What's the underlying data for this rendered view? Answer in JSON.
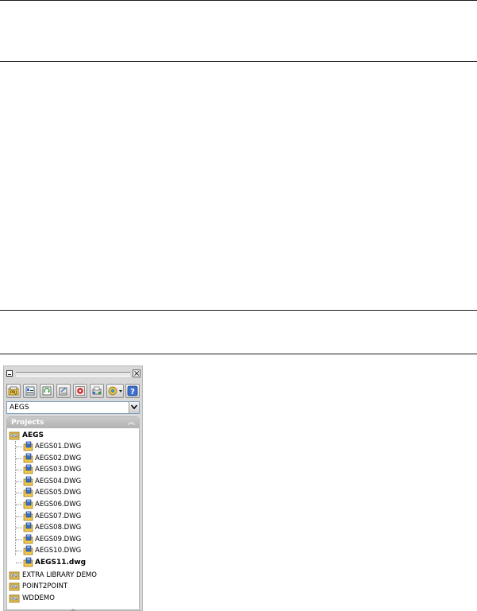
{
  "toolbar": {
    "buttons": [
      {
        "icon": "open-project-icon",
        "tooltip": ""
      },
      {
        "icon": "project-properties-icon",
        "tooltip": ""
      },
      {
        "icon": "update-retag-icon",
        "tooltip": ""
      },
      {
        "icon": "project-task-list-icon",
        "tooltip": ""
      },
      {
        "icon": "project-wide-utilities-icon",
        "tooltip": ""
      },
      {
        "icon": "plot-project-icon",
        "tooltip": ""
      },
      {
        "icon": "project-reports-icon",
        "tooltip": ""
      },
      {
        "icon": "help-icon",
        "tooltip": ""
      }
    ]
  },
  "project_selector": {
    "value": "AEGS"
  },
  "tree": {
    "header": "Projects",
    "active_project": "AEGS",
    "drawings": [
      "AEGS01.DWG",
      "AEGS02.DWG",
      "AEGS03.DWG",
      "AEGS04.DWG",
      "AEGS05.DWG",
      "AEGS06.DWG",
      "AEGS07.DWG",
      "AEGS08.DWG",
      "AEGS09.DWG",
      "AEGS10.DWG",
      "AEGS11.dwg"
    ],
    "other_projects": [
      "EXTRA LIBRARY DEMO",
      "POINT2POINT",
      "WDDEMO"
    ]
  },
  "colors": {
    "panel_bg": "#d8d8d8",
    "header_bg": "#b3b3b3",
    "folder_yellow": "#f2c94c",
    "drawing_blue": "#3b6fc4",
    "help_blue": "#3a6fd0"
  }
}
